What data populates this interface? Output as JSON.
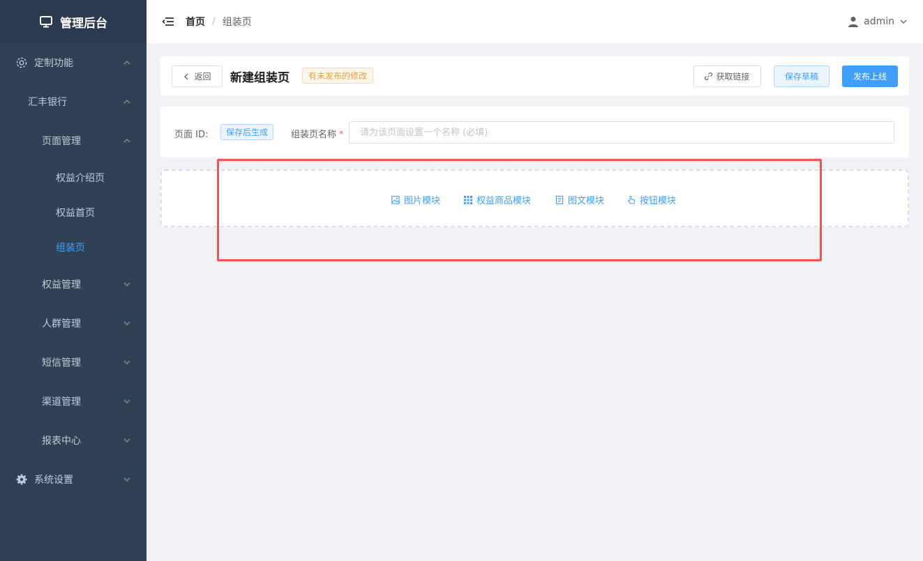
{
  "app": {
    "title": "管理后台"
  },
  "colors": {
    "accent": "#409eff",
    "sidebar_bg": "#304156",
    "warning": "#e6a23c",
    "highlight": "#f05454"
  },
  "sidebar": {
    "items": [
      {
        "label": "定制功能",
        "icon": "gear-icon",
        "expanded": true
      },
      {
        "label": "汇丰银行",
        "expanded": true
      },
      {
        "label": "页面管理",
        "expanded": true
      },
      {
        "label": "权益介绍页"
      },
      {
        "label": "权益首页"
      },
      {
        "label": "组装页",
        "active": true
      },
      {
        "label": "权益管理",
        "expanded": false
      },
      {
        "label": "人群管理",
        "expanded": false
      },
      {
        "label": "短信管理",
        "expanded": false
      },
      {
        "label": "渠道管理",
        "expanded": false
      },
      {
        "label": "报表中心",
        "expanded": false
      },
      {
        "label": "系统设置",
        "icon": "settings-icon",
        "expanded": false
      }
    ]
  },
  "header": {
    "breadcrumb": {
      "home": "首页",
      "separator": "/",
      "current": "组装页"
    },
    "user": "admin"
  },
  "toolbar": {
    "back_label": "返回",
    "title": "新建组装页",
    "status_tag": "有未发布的修改",
    "link_label": "获取链接",
    "draft_label": "保存草稿",
    "publish_label": "发布上线"
  },
  "form": {
    "id_label": "页面 ID:",
    "id_value": "保存后生成",
    "name_label": "组装页名称",
    "required_mark": "*",
    "name_placeholder": "请为该页面设置一个名称 (必填)",
    "name_value": ""
  },
  "modules": [
    {
      "label": "图片模块",
      "icon": "image-icon"
    },
    {
      "label": "权益商品模块",
      "icon": "grid-icon"
    },
    {
      "label": "图文模块",
      "icon": "document-icon"
    },
    {
      "label": "按钮模块",
      "icon": "pointer-icon"
    }
  ]
}
